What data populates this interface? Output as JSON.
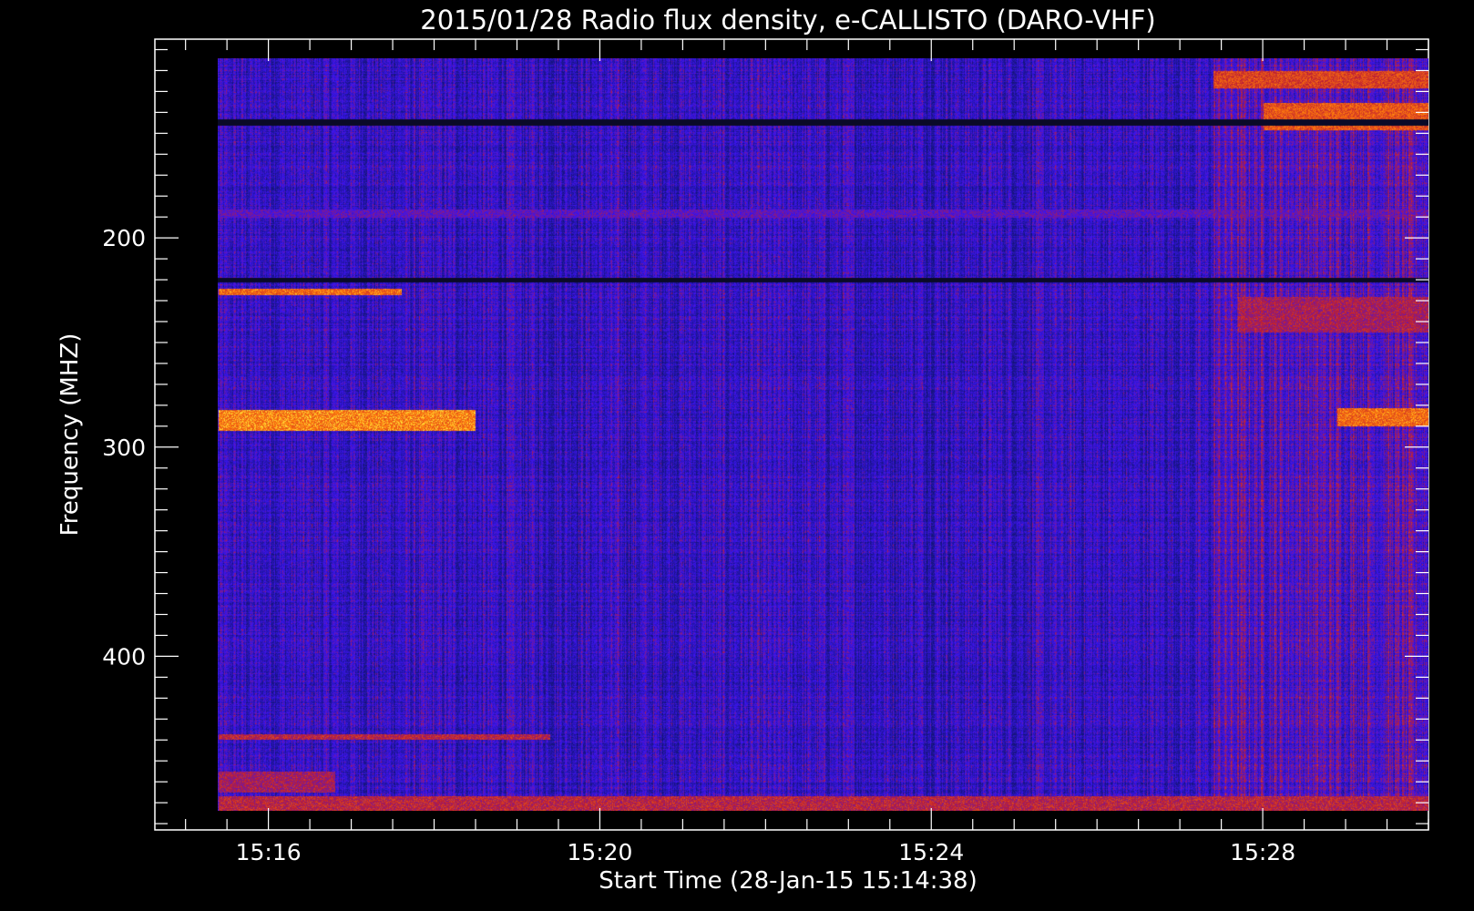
{
  "chart_data": {
    "type": "heatmap",
    "title": "2015/01/28  Radio flux density, e-CALLISTO (DARO-VHF)",
    "xlabel": "Start Time (28-Jan-15 15:14:38)",
    "ylabel": "Frequency (MHZ)",
    "x_range_minutes": [
      14.63,
      30.0
    ],
    "x_ticks": [
      {
        "minute": 16,
        "label": "15:16"
      },
      {
        "minute": 20,
        "label": "15:20"
      },
      {
        "minute": 24,
        "label": "15:24"
      },
      {
        "minute": 28,
        "label": "15:28"
      }
    ],
    "y_range_mhz": [
      105,
      483
    ],
    "y_ticks": [
      {
        "mhz": 200,
        "label": "200"
      },
      {
        "mhz": 300,
        "label": "300"
      },
      {
        "mhz": 400,
        "label": "400"
      }
    ],
    "data_range": {
      "t_start": 15.39,
      "t_end": 30.0,
      "f_start": 114,
      "f_end": 474
    },
    "colors": {
      "background": "#000000",
      "base": "#2a2ae8",
      "mid": "#b0201f",
      "hot": "#ff7a10",
      "peak": "#ffff40"
    },
    "bursts": [
      {
        "t0": 15.4,
        "t1": 18.5,
        "f0": 282,
        "f1": 292,
        "intensity": 0.85
      },
      {
        "t0": 28.9,
        "t1": 30.0,
        "f0": 281,
        "f1": 290,
        "intensity": 0.8
      },
      {
        "t0": 27.4,
        "t1": 30.0,
        "f0": 120,
        "f1": 128,
        "intensity": 0.7
      },
      {
        "t0": 28.0,
        "t1": 30.0,
        "f0": 135,
        "f1": 148,
        "intensity": 0.75
      },
      {
        "t0": 27.7,
        "t1": 30.0,
        "f0": 228,
        "f1": 245,
        "intensity": 0.55
      },
      {
        "t0": 15.4,
        "t1": 17.6,
        "f0": 224,
        "f1": 227,
        "intensity": 0.8
      },
      {
        "t0": 15.4,
        "t1": 19.4,
        "f0": 437,
        "f1": 440,
        "intensity": 0.6
      },
      {
        "t0": 15.4,
        "t1": 16.8,
        "f0": 455,
        "f1": 465,
        "intensity": 0.55
      },
      {
        "t0": 15.4,
        "t1": 30.0,
        "f0": 186,
        "f1": 190,
        "intensity": 0.4
      },
      {
        "t0": 15.4,
        "t1": 30.0,
        "f0": 467,
        "f1": 474,
        "intensity": 0.6
      }
    ],
    "gaps": [
      {
        "t0": 15.39,
        "t1": 30.0,
        "f0": 219,
        "f1": 221
      },
      {
        "t0": 15.39,
        "t1": 30.0,
        "f0": 143,
        "f1": 146
      }
    ]
  }
}
